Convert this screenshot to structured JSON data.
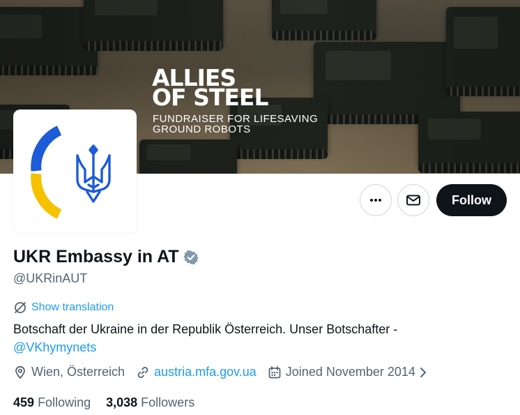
{
  "banner": {
    "title": "ALLIES\nOF STEEL",
    "subtitle": "FUNDRAISER FOR LIFESAVING\nGROUND ROBOTS"
  },
  "avatar": {
    "icon": "ukraine-trident-emblem",
    "colors": {
      "blue": "#1d5bd8",
      "yellow": "#f6c100"
    }
  },
  "actions": {
    "more_icon": "more-horizontal-icon",
    "message_icon": "envelope-icon",
    "follow_label": "Follow"
  },
  "profile": {
    "display_name": "UKR Embassy in AT",
    "verified_icon": "verified-badge-gray",
    "handle": "@UKRinAUT",
    "show_translation": "Show translation",
    "bio_text": "Botschaft der Ukraine in der Republik Österreich. Unser Botschafter -",
    "bio_mention": "@VKhymynets",
    "location": "Wien, Österreich",
    "website": "austria.mfa.gov.ua",
    "joined": "Joined November 2014"
  },
  "stats": {
    "following_count": "459",
    "following_label": "Following",
    "followers_count": "3,038",
    "followers_label": "Followers"
  },
  "colors": {
    "accent": "#1d9bf0",
    "text_primary": "#0f1419",
    "text_secondary": "#536471",
    "button_dark": "#0f1419"
  }
}
